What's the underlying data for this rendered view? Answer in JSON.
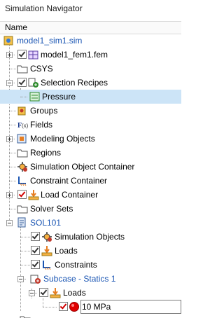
{
  "panel_title": "Simulation Navigator",
  "column_header": "Name",
  "nodes": [
    {
      "label": "model1_sim1.sim",
      "icon": "sim-file-icon"
    },
    {
      "label": "model1_fem1.fem",
      "icon": "fem-file-icon"
    },
    {
      "label": "CSYS",
      "icon": "folder-icon"
    },
    {
      "label": "Selection Recipes",
      "icon": "selection-recipes-icon"
    },
    {
      "label": "Pressure",
      "icon": "recipe-icon"
    },
    {
      "label": "Groups",
      "icon": "groups-icon"
    },
    {
      "label": "Fields",
      "icon": "fields-icon"
    },
    {
      "label": "Modeling Objects",
      "icon": "modeling-objects-icon"
    },
    {
      "label": "Regions",
      "icon": "folder-icon"
    },
    {
      "label": "Simulation Object Container",
      "icon": "simulation-object-icon"
    },
    {
      "label": "Constraint Container",
      "icon": "constraint-icon"
    },
    {
      "label": "Load Container",
      "icon": "load-icon"
    },
    {
      "label": "Solver Sets",
      "icon": "folder-icon"
    },
    {
      "label": "SOL101",
      "icon": "solution-icon"
    },
    {
      "label": "Simulation Objects",
      "icon": "simulation-object-icon"
    },
    {
      "label": "Loads",
      "icon": "load-icon"
    },
    {
      "label": "Constraints",
      "icon": "constraint-icon"
    },
    {
      "label": "Subcase - Statics 1",
      "icon": "subcase-icon"
    },
    {
      "label": "Loads",
      "icon": "load-icon"
    },
    {
      "label": "10 MPa",
      "icon": "pressure-load-icon"
    }
  ]
}
